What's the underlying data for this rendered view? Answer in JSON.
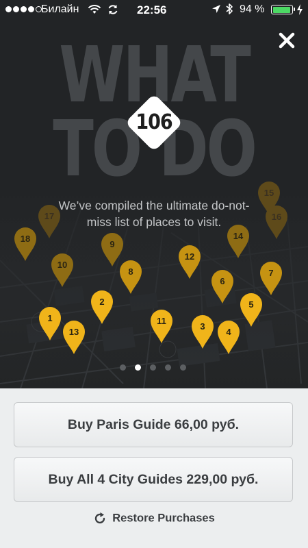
{
  "status_bar": {
    "carrier": "Билайн",
    "time": "22:56",
    "battery_percent": "94 %",
    "battery_level": 0.94,
    "signal_bars_filled": 4,
    "signal_bars_total": 5
  },
  "hero": {
    "title_line1": "WHAT",
    "title_line2": "TO DO",
    "badge_number": "106",
    "tagline": "We’ve compiled the ultimate do-not-miss list of places to visit."
  },
  "map_pins": [
    {
      "label": "1",
      "state": "bright"
    },
    {
      "label": "2",
      "state": "bright"
    },
    {
      "label": "3",
      "state": "bright"
    },
    {
      "label": "4",
      "state": "bright"
    },
    {
      "label": "5",
      "state": "bright"
    },
    {
      "label": "6",
      "state": "mid"
    },
    {
      "label": "7",
      "state": "mid"
    },
    {
      "label": "8",
      "state": "mid"
    },
    {
      "label": "9",
      "state": "dim"
    },
    {
      "label": "10",
      "state": "dim"
    },
    {
      "label": "11",
      "state": "bright"
    },
    {
      "label": "12",
      "state": "mid"
    },
    {
      "label": "13",
      "state": "bright"
    },
    {
      "label": "14",
      "state": "dim"
    },
    {
      "label": "15",
      "state": "faint"
    },
    {
      "label": "16",
      "state": "faint"
    },
    {
      "label": "17",
      "state": "faint"
    },
    {
      "label": "18",
      "state": "dim"
    }
  ],
  "pagination": {
    "total": 5,
    "active": 2
  },
  "actions": {
    "buy_city_label": "Buy Paris Guide 66,00 руб.",
    "buy_all_label": "Buy All 4 City Guides 229,00 руб.",
    "restore_label": "Restore Purchases"
  },
  "colors": {
    "pin_bright": "#f0b41a",
    "pin_mid": "#c69312",
    "pin_dim": "#8e6c14",
    "pin_faint": "#5e4a1a",
    "battery": "#4cd964",
    "background_dark": "#222426",
    "panel": "#eceeef"
  },
  "icons": [
    "signal-dots-icon",
    "wifi-icon",
    "sync-icon",
    "location-arrow-icon",
    "bluetooth-icon",
    "battery-icon",
    "charging-bolt-icon",
    "close-icon",
    "map-pin-icon",
    "restore-icon"
  ]
}
